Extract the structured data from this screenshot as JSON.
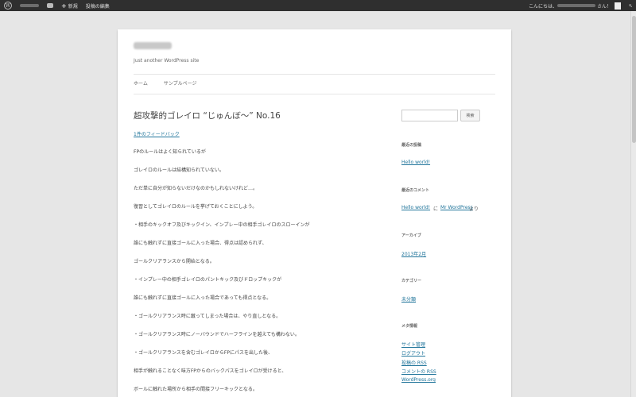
{
  "adminbar": {
    "new_label": "新規",
    "edit_post": "投稿の編集",
    "greeting_prefix": "こんにちは、",
    "greeting_suffix": "さん！"
  },
  "site": {
    "description": "Just another WordPress site"
  },
  "nav": [
    "ホーム",
    "サンプルページ"
  ],
  "entry": {
    "title": "超攻撃的ゴレイロ “じゅんぼ〜” No.16",
    "feedback": "1件のフィードバック",
    "paragraphs": [
      "FPのルールはよく知られているが",
      "ゴレイロのルールは結構知られていない。",
      "ただ単に自分が知らないだけなのかもしれないけれど…。",
      "復習としてゴレイロのルールを挙げておくことにしよう。",
      "・相手のキックオフ及びキックイン、インプレー中の相手ゴレイロのスローインが",
      "誰にも触れずに直接ゴールに入った場合、得点は認められず、",
      "ゴールクリアランスから開始となる。",
      "・インプレー中の相手ゴレイロのパントキック及びドロップキックが",
      "誰にも触れずに直接ゴールに入った場合であっても得点となる。",
      "・ゴールクリアランス時に蹴ってしまった場合は、やり直しとなる。",
      "・ゴールクリアランス時にノーバウンドでハーフラインを越えても構わない。",
      "・ゴールクリアランスを含むゴレイロからFPにパスを出した後、",
      "相手が触れることなく味方FPからのバックパスをゴレイロが受けると、",
      "ボールに触れた場所から相手の間接フリーキックとなる。"
    ]
  },
  "sidebar": {
    "search_button": "検索",
    "recent_posts_title": "最近の投稿",
    "recent_posts": [
      "Hello world!"
    ],
    "recent_comments_title": "最近のコメント",
    "recent_comment": {
      "post": "Hello world!",
      "connector": "に",
      "author": "Mr WordPress",
      "suffix": "より"
    },
    "archives_title": "アーカイブ",
    "archives": [
      "2013年2月"
    ],
    "categories_title": "カテゴリー",
    "categories": [
      "未分類"
    ],
    "meta_title": "メタ情報",
    "meta_links": [
      "サイト管理",
      "ログアウト",
      "投稿の RSS",
      "コメントの RSS",
      "WordPress.org"
    ]
  }
}
